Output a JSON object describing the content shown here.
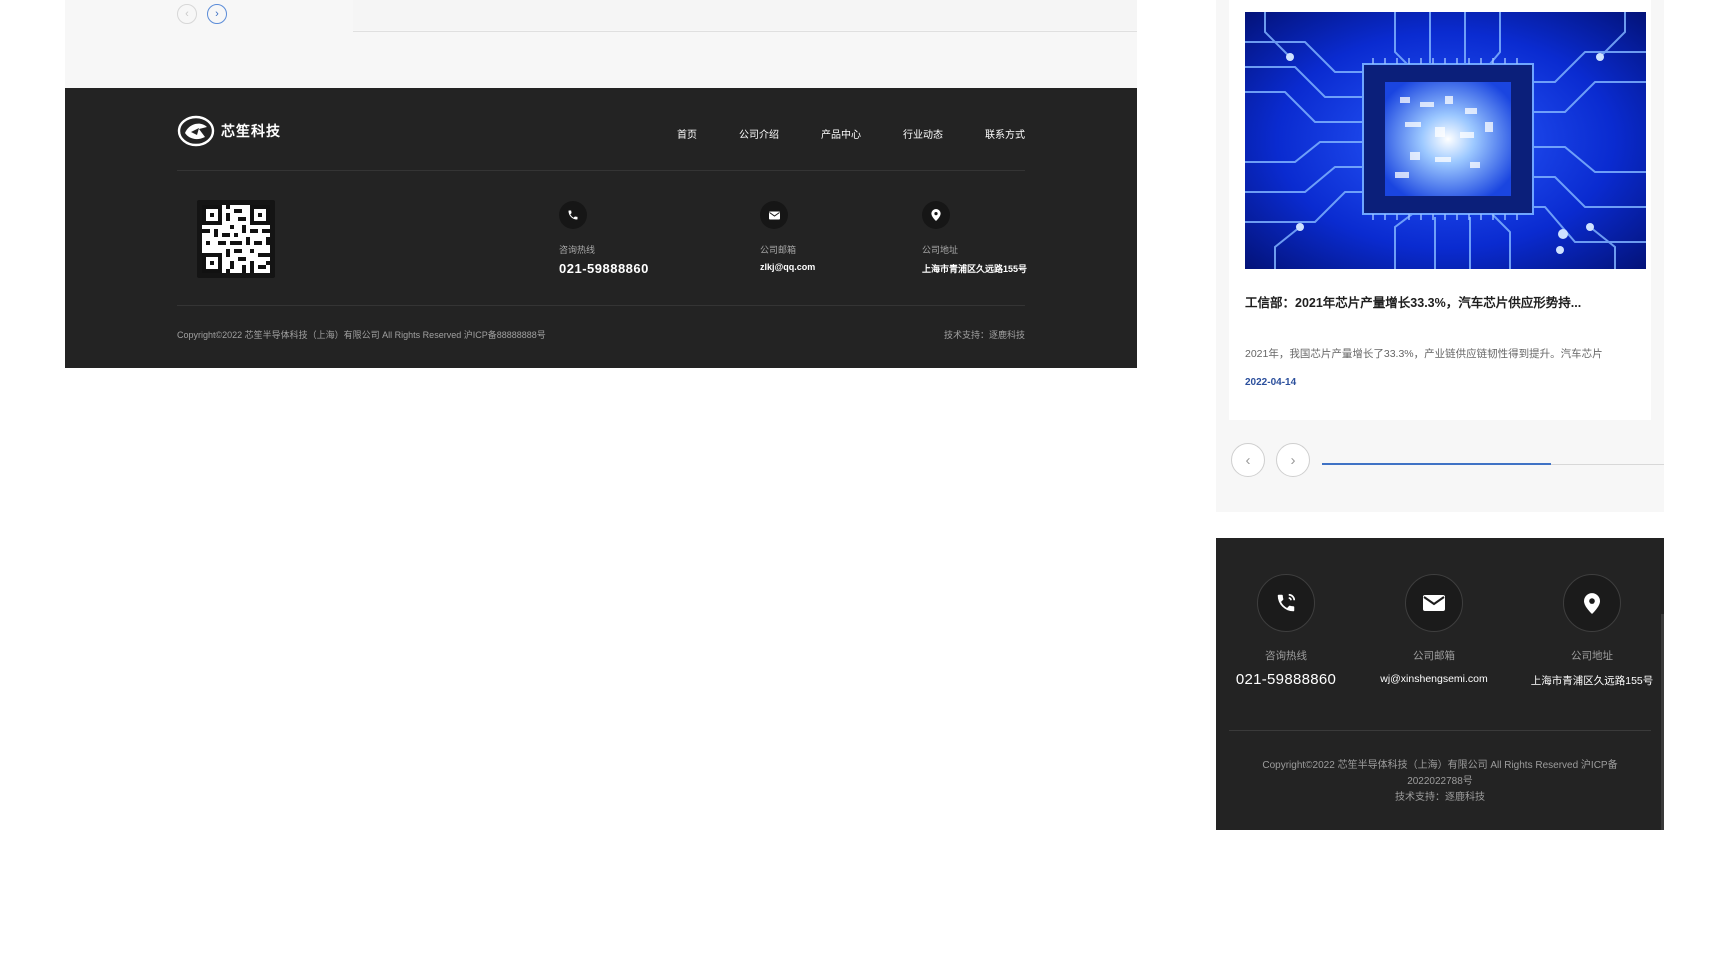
{
  "desktop": {
    "carousel": {
      "prev_icon": "chevron-left-icon",
      "next_icon": "chevron-right-icon"
    },
    "footer": {
      "logo_text": "芯笙科技",
      "nav": [
        "首页",
        "公司介绍",
        "产品中心",
        "行业动态",
        "联系方式"
      ],
      "contacts": {
        "phone": {
          "label": "咨询热线",
          "value": "021-59888860",
          "icon": "phone-icon"
        },
        "email": {
          "label": "公司邮箱",
          "value": "zlkj@qq.com",
          "icon": "mail-icon"
        },
        "address": {
          "label": "公司地址",
          "value": "上海市青浦区久远路155号",
          "icon": "location-pin-icon"
        }
      },
      "copyright": "Copyright©2022 芯笙半导体科技（上海）有限公司 All Rights Reserved  沪ICP备88888888号",
      "support": "技术支持：逐鹿科技"
    }
  },
  "mobile": {
    "news": {
      "title": "工信部：2021年芯片产量增长33.3%，汽车芯片供应形势持...",
      "excerpt": "2021年，我国芯片产量增长了33.3%，产业链供应链韧性得到提升。汽车芯片",
      "date": "2022-04-14"
    },
    "carousel": {
      "prev_icon": "chevron-left-icon",
      "next_icon": "chevron-right-icon",
      "progress": 0.67
    },
    "footer": {
      "contacts": {
        "phone": {
          "label": "咨询热线",
          "value": "021-59888860",
          "icon": "phone-icon"
        },
        "email": {
          "label": "公司邮箱",
          "value": "wj@xinshengsemi.com",
          "icon": "mail-icon"
        },
        "address": {
          "label": "公司地址",
          "value": "上海市青浦区久远路155号",
          "icon": "location-pin-icon"
        }
      },
      "copyright_line1": "Copyright©2022 芯笙半导体科技（上海）有限公司 All Rights Reserved 沪ICP备",
      "copyright_line2": "2022022788号",
      "support": "技术支持：逐鹿科技"
    }
  },
  "colors": {
    "footer_bg": "#232323",
    "accent": "#3f72c5",
    "date": "#2b4f9c"
  }
}
